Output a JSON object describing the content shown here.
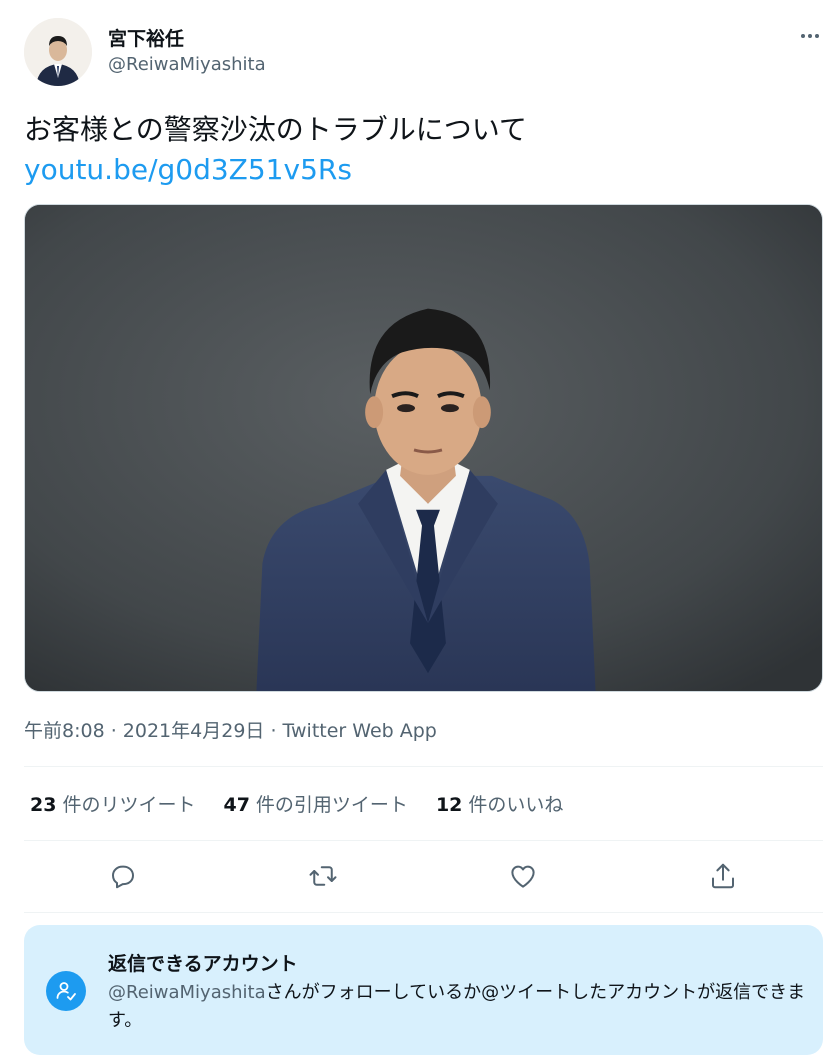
{
  "user": {
    "display_name": "宮下裕任",
    "handle": "@ReiwaMiyashita"
  },
  "tweet": {
    "text": "お客様との警察沙汰のトラブルについて",
    "link": "youtu.be/g0d3Z51v5Rs"
  },
  "meta": {
    "time": "午前8:08",
    "separator": " · ",
    "date": "2021年4月29日",
    "source": "Twitter Web App"
  },
  "stats": {
    "retweets_count": "23",
    "retweets_label": "件のリツイート",
    "quotes_count": "47",
    "quotes_label": "件の引用ツイート",
    "likes_count": "12",
    "likes_label": "件のいいね"
  },
  "actions": {
    "icons": [
      "reply-icon",
      "retweet-icon",
      "like-icon",
      "share-icon"
    ]
  },
  "reply_settings": {
    "title": "返信できるアカウント",
    "mention": "@ReiwaMiyashita",
    "description": "さんがフォローしているか@ツイートしたアカウントが返信できます。"
  },
  "colors": {
    "accent": "#1d9bf0",
    "secondary_text": "#536471",
    "reply_box_bg": "#d8f0fd"
  }
}
